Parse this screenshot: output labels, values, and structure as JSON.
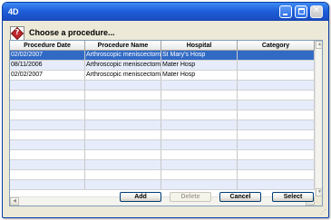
{
  "window": {
    "app_icon_text": "4D",
    "controls": {
      "minimize": "minimize",
      "maximize": "maximize",
      "close": "✕"
    }
  },
  "dialog": {
    "icon": "procedure-question-icon",
    "icon_text": "?",
    "heading": "Choose a procedure..."
  },
  "table": {
    "columns": [
      "Procedure Date",
      "Procedure Name",
      "Hospital",
      "Category"
    ],
    "rows": [
      {
        "date": "02/02/2007",
        "name": "Arthroscopic meniscectomy c",
        "hospital": "St Mary's Hosp",
        "category": "",
        "selected": true
      },
      {
        "date": "08/11/2006",
        "name": "Arthroscopic meniscectomy c",
        "hospital": "Mater Hosp",
        "category": "",
        "selected": false
      },
      {
        "date": "02/02/2007",
        "name": "Arthroscopic meniscectomy c",
        "hospital": "Mater Hosp",
        "category": "",
        "selected": false
      }
    ],
    "empty_row_count": 11,
    "scroll": {
      "up": "▲",
      "down": "▼",
      "left": "◀",
      "right": "▶"
    }
  },
  "buttons": {
    "add": "Add",
    "delete": "Delete",
    "cancel": "Cancel",
    "select": "Select"
  },
  "colors": {
    "titlebar": "#1f5fd9",
    "selection": "#316ac5",
    "alt_row": "#e6ecfa"
  }
}
